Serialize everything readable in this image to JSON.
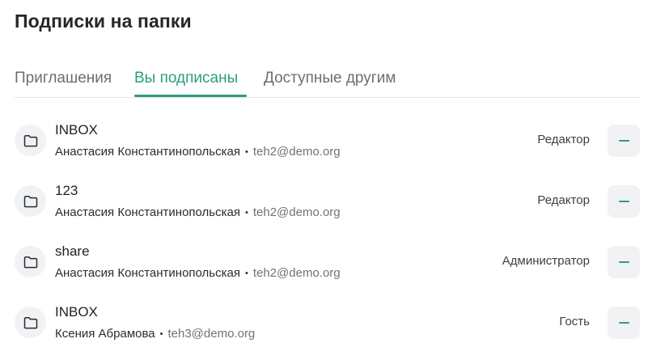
{
  "page": {
    "title": "Подписки на папки"
  },
  "tabs": [
    {
      "label": "Приглашения",
      "active": false
    },
    {
      "label": "Вы подписаны",
      "active": true
    },
    {
      "label": "Доступные другим",
      "active": false
    }
  ],
  "subscriptions": [
    {
      "folder": "INBOX",
      "owner": "Анастасия Константинопольская",
      "email": "teh2@demo.org",
      "role": "Редактор"
    },
    {
      "folder": "123",
      "owner": "Анастасия Константинопольская",
      "email": "teh2@demo.org",
      "role": "Редактор"
    },
    {
      "folder": "share",
      "owner": "Анастасия Константинопольская",
      "email": "teh2@demo.org",
      "role": "Администратор"
    },
    {
      "folder": "INBOX",
      "owner": "Ксения Абрамова",
      "email": "teh3@demo.org",
      "role": "Гость"
    }
  ],
  "separator": "•",
  "colors": {
    "accent": "#2e9c82",
    "icon_bg": "#f1f2f4",
    "muted_text": "#6f7278"
  },
  "icons": {
    "folder": "folder-icon",
    "remove": "minus-icon"
  }
}
